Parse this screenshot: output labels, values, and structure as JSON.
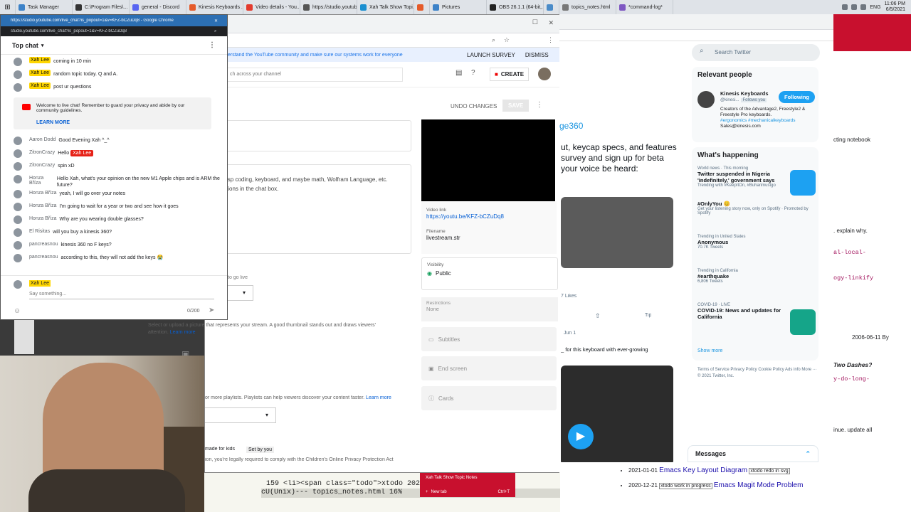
{
  "taskbar": {
    "items": [
      {
        "label": "Task Manager",
        "color": "#3c82c8"
      },
      {
        "label": "C:\\Program Files\\...",
        "color": "#333333"
      },
      {
        "label": "general - Discord",
        "color": "#5865f2"
      },
      {
        "label": "Kinesis Keyboards ...",
        "color": "#e55b2a"
      },
      {
        "label": "Video details - You...",
        "color": "#e33b2e"
      },
      {
        "label": "https://studio.youtub...",
        "color": "#555555"
      },
      {
        "label": "Xah Talk Show Topi...",
        "color": "#1a8fd0"
      },
      {
        "label": "",
        "color": "#e55b2a"
      },
      {
        "label": "Pictures",
        "color": "#3c82c8"
      },
      {
        "label": "OBS 26.1.1 (64-bit,...",
        "color": "#222222"
      },
      {
        "label": "",
        "color": "#4a8bc8"
      },
      {
        "label": "topics_notes.html",
        "color": "#777777"
      },
      {
        "label": "*command-log*",
        "color": "#7e57c2"
      }
    ],
    "tray": {
      "lang": "ENG",
      "time": "11:06 PM",
      "date": "6/5/2021"
    }
  },
  "chat_window": {
    "title": "https://studio.youtube.com/live_chat?is_popout=1&v=KFZ-bCZuDq8 - Google Chrome",
    "url": "studio.youtube.com/live_chat?is_popout=1&v=KFZ-bCZuDq8",
    "header": "Top chat",
    "top_messages": [
      {
        "author": "Xah Lee",
        "text": "coming in 10 min"
      },
      {
        "author": "Xah Lee",
        "text": "random topic today. Q and A."
      },
      {
        "author": "Xah Lee",
        "text": "post ur questions"
      }
    ],
    "welcome": "Welcome to live chat! Remember to guard your privacy and abide by our community guidelines.",
    "learn_more": "LEARN MORE",
    "messages": [
      {
        "author": "Aaron Dodd",
        "text": "Good Evening Xah ^_^"
      },
      {
        "author": "ZitronCrazy",
        "text": "Hello",
        "tag": "Xah Lee"
      },
      {
        "author": "ZitronCrazy",
        "text": "spin xD"
      },
      {
        "author": "Honza Bříza",
        "text": "Hello Xah, what's your opinion on the new M1 Apple chips and is ARM the future?"
      },
      {
        "author": "Honza Bříza",
        "text": "yeah, I will go over your notes"
      },
      {
        "author": "Honza Bříza",
        "text": "I'm going to wait for a year or two and see how it goes"
      },
      {
        "author": "Honza Bříza",
        "text": "Why are you wearing double glasses?"
      },
      {
        "author": "El Risitas",
        "text": "will you buy a kinesis 360?"
      },
      {
        "author": "pancreasnou",
        "text": "kinesis 360 no F keys?"
      },
      {
        "author": "pancreasnou",
        "text": "according to this, they will not add the keys 😭"
      }
    ],
    "composer": {
      "author": "Xah Lee",
      "placeholder": "Say something...",
      "counter": "0/200"
    }
  },
  "studio": {
    "banner": "erstand the YouTube community and make sure our systems work for everyone",
    "launch_survey": "LAUNCH SURVEY",
    "dismiss": "DISMISS",
    "search_placeholder": "ch across your channel",
    "create": "CREATE",
    "undo": "UNDO CHANGES",
    "save": "SAVE",
    "desc_line1": "isp coding, keyboard, and maybe math, Wolfram Language, etc.",
    "desc_line2": "tions in the chat box.",
    "video_link_label": "Video link",
    "video_link": "https://youtu.be/KFZ-bCZuDq8",
    "filename_label": "Filename",
    "filename": "livestream.str",
    "visibility_label": "Visibility",
    "visibility": "Public",
    "restrictions_label": "Restrictions",
    "restrictions": "None",
    "subtitles": "Subtitles",
    "end_screen": "End screen",
    "cards": "Cards",
    "go_live": "to go live",
    "thumb_text": "Select or upload a picture that represents your stream. A good thumbnail stands out and draws viewers' attention.",
    "thumb_learn": "Learn more",
    "playlist_text": "or more playlists. Playlists can help viewers discover your content faster.",
    "playlist_learn": "Learn more",
    "made_for_kids": "made for kids",
    "set_by_you": "Set by you",
    "coppa": "ion, you're legally required to comply with the Children's Online Privacy Protection Act"
  },
  "kinesis_page": {
    "link": "ge360",
    "para1": "ut, keycap specs, and features",
    "para2": "survey and sign up for beta",
    "para3": "your voice be heard:",
    "likes": "7 Likes",
    "tip": "Tip",
    "date": "Jun 1",
    "caption": "_ for this keyboard with ever-growing"
  },
  "twitter": {
    "search_placeholder": "Search Twitter",
    "relevant_title": "Relevant people",
    "person_name": "Kinesis Keyboards",
    "person_handle": "@kinesi...",
    "follows_you": "Follows you",
    "following": "Following",
    "person_bio": "Creators of the Advantage2, Freestyle2 & Freestyle Pro keyboards.",
    "person_tags": "#ergonomics #mechanicalkeyboards",
    "person_email": "Sales@kinesis.com",
    "happening_title": "What's happening",
    "trends": [
      {
        "cat": "World news · This morning",
        "name": "Twitter suspended in Nigeria 'indefinitely,' government says",
        "count": "Trending with #KeepItOn, #Buharimustgo"
      },
      {
        "cat": "",
        "name": "#OnlyYou 😊",
        "count": "Get your listening story now, only on Spotify · Promoted by Spotify"
      },
      {
        "cat": "Trending in United States",
        "name": "Anonymous",
        "count": "70.7K Tweets"
      },
      {
        "cat": "Trending in California",
        "name": "#earthquake",
        "count": "6,806 Tweets"
      },
      {
        "cat": "COVID-19 · LIVE",
        "name": "COVID-19: News and updates for California",
        "count": ""
      }
    ],
    "show_more": "Show more",
    "footer": "Terms of Service  Privacy Policy  Cookie Policy  Ads info  More ···  © 2021 Twitter, Inc.",
    "messages": "Messages"
  },
  "farright": {
    "line1": "cting notebook",
    "line2": ". explain why.",
    "line3": "al-local-",
    "line4": "ogy-linkify",
    "line5": "2006-06-11 By",
    "line6": "Two Dashes?",
    "line7": "y-do-long-",
    "line8": "inue. update all"
  },
  "terminal": {
    "line": "159 <li><span class=\"todo\">xtodo 202",
    "status": "cU(Unix)---  topics_notes.html  16%",
    "popup_title": "Xah Talk Show Topic Notes",
    "new_tab": "New tab",
    "shortcut": "Ctrl+T"
  },
  "bottom_list": [
    {
      "date": "2021-01-01",
      "title": "Emacs Key Layout Diagram",
      "tag": "xtodo redo in svg"
    },
    {
      "date": "2020-12-21",
      "title": "Emacs Magit Mode Problem",
      "tag": "xtodo work in progress"
    }
  ]
}
